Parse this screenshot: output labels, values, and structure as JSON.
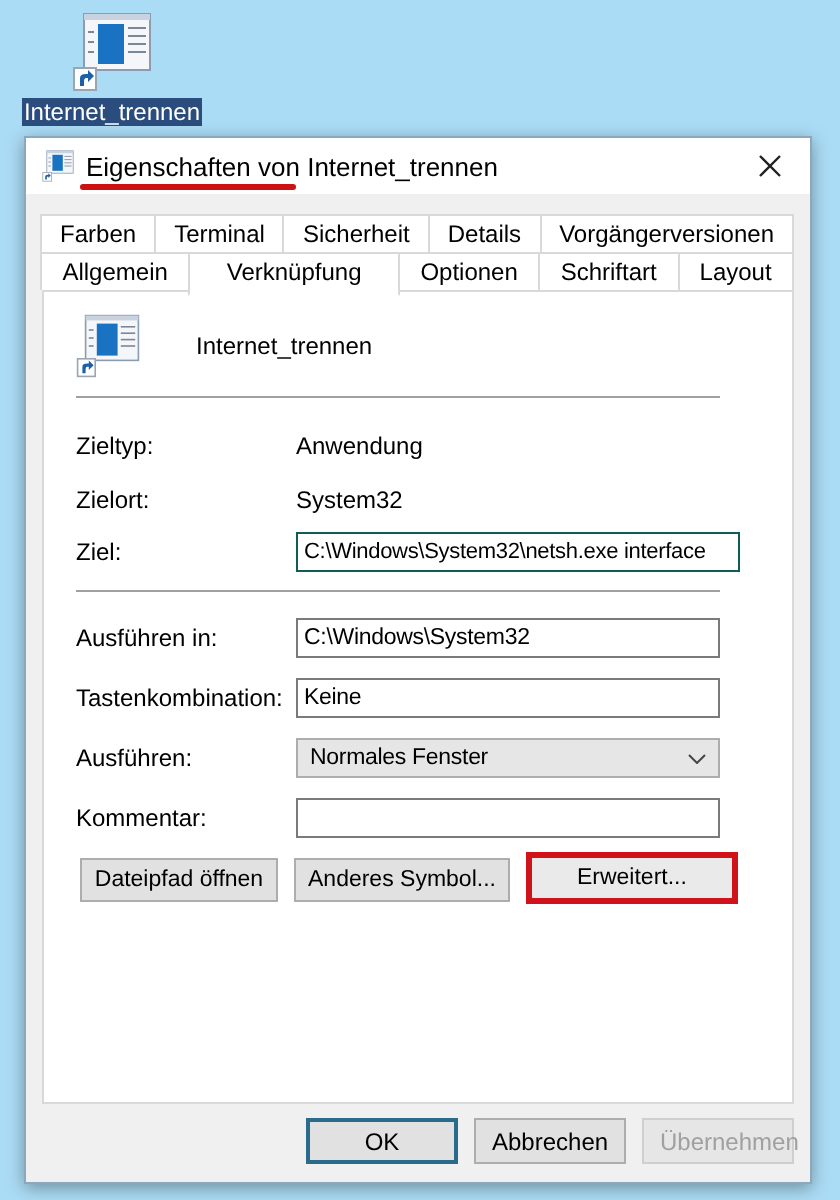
{
  "desktop_icon": {
    "label": "Internet_trennen",
    "selected": true
  },
  "window": {
    "title": "Eigenschaften von Internet_trennen",
    "title_underlined": true
  },
  "tab_rows": [
    [
      {
        "label": "Farben",
        "selected": false
      },
      {
        "label": "Terminal",
        "selected": false
      },
      {
        "label": "Sicherheit",
        "selected": false
      },
      {
        "label": "Details",
        "selected": false
      },
      {
        "label": "Vorgängerversionen",
        "selected": false
      }
    ],
    [
      {
        "label": "Allgemein",
        "selected": false
      },
      {
        "label": "Verknüpfung",
        "selected": true
      },
      {
        "label": "Optionen",
        "selected": false
      },
      {
        "label": "Schriftart",
        "selected": false
      },
      {
        "label": "Layout",
        "selected": false
      }
    ]
  ],
  "shortcut": {
    "name": "Internet_trennen"
  },
  "info": [
    {
      "label": "Zieltyp:",
      "value": "Anwendung"
    },
    {
      "label": "Zielort:",
      "value": "System32"
    }
  ],
  "target": {
    "label": "Ziel:",
    "value": "C:\\Windows\\System32\\netsh.exe interface",
    "focused": true
  },
  "fields": [
    {
      "kind": "text",
      "label": "Ausführen in:",
      "value": "C:\\Windows\\System32"
    },
    {
      "kind": "text",
      "label": "Tastenkombination:",
      "value": "Keine"
    },
    {
      "kind": "dropdown",
      "label": "Ausführen:",
      "value": "Normales Fenster"
    },
    {
      "kind": "text",
      "label": "Kommentar:"
    }
  ],
  "action_buttons": [
    {
      "label": "Dateipfad öffnen",
      "highlighted": false
    },
    {
      "label": "Anderes Symbol...",
      "highlighted": false
    },
    {
      "label": "Erweitert...",
      "highlighted": true
    }
  ],
  "footer_buttons": [
    {
      "label": "OK",
      "default": true,
      "disabled": false
    },
    {
      "label": "Abbrechen",
      "default": false,
      "disabled": false
    },
    {
      "label": "Übernehmen",
      "default": false,
      "disabled": true
    }
  ]
}
